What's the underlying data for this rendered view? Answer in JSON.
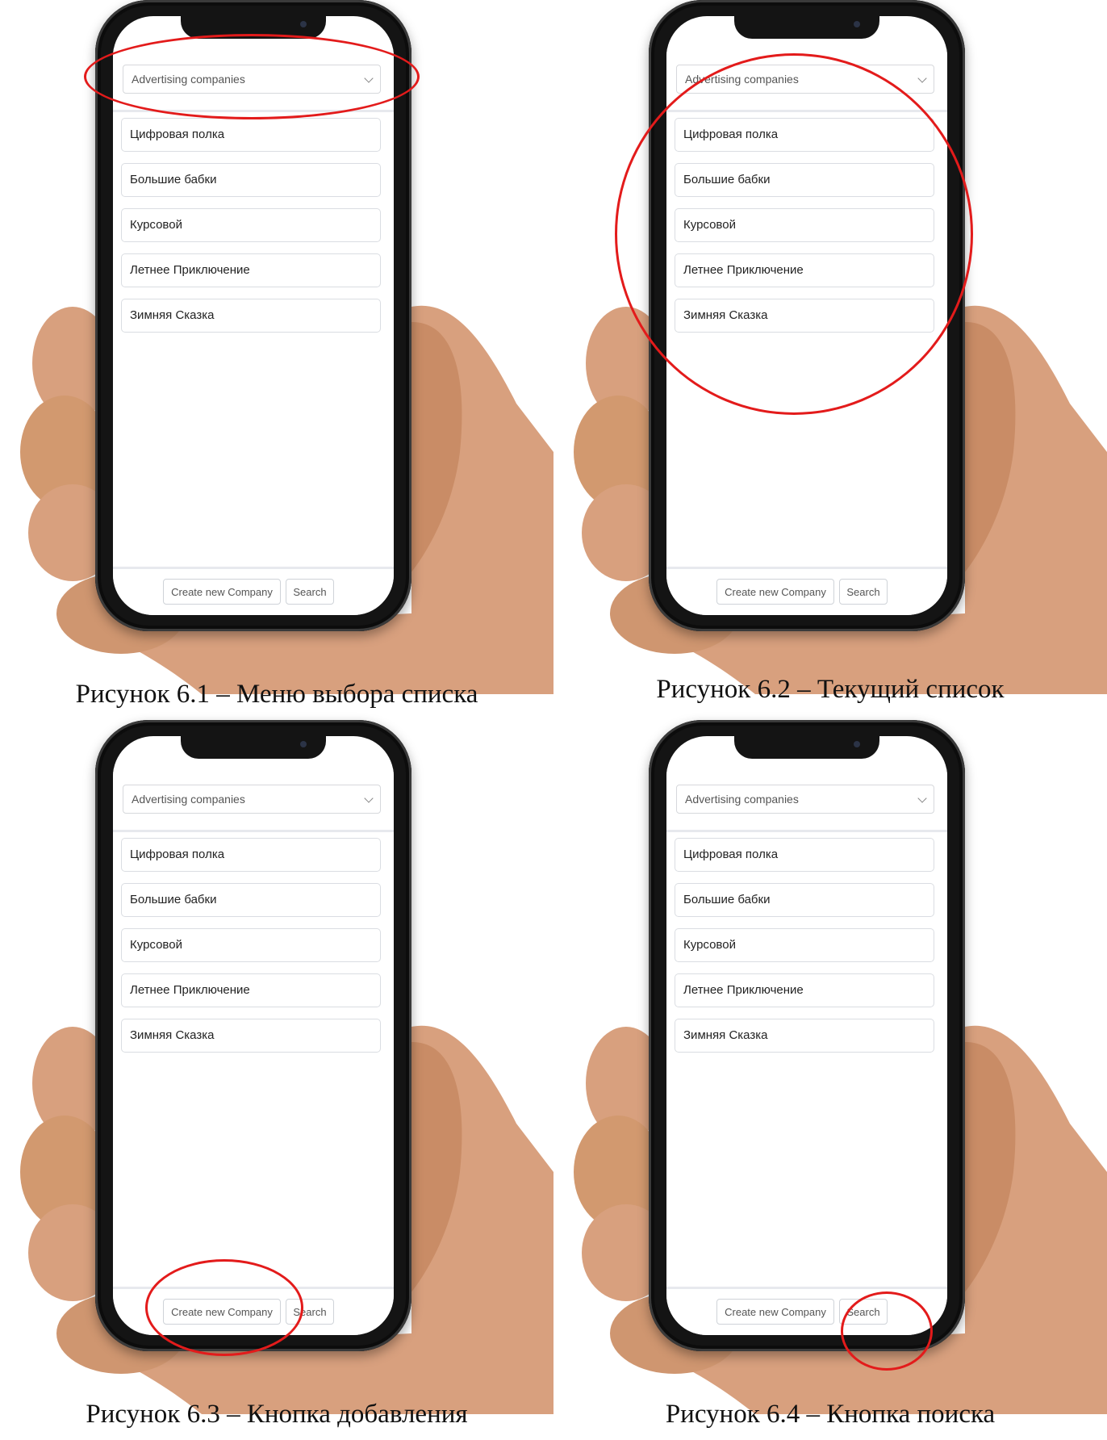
{
  "app": {
    "select_value": "Advertising companies",
    "list_items": [
      "Цифровая полка",
      "Большие бабки",
      "Курсовой",
      "Летнее Приключение",
      "Зимняя Сказка"
    ],
    "create_button": "Create new Company",
    "search_button": "Search"
  },
  "captions": [
    "Рисунок 6.1 – Меню выбора списка",
    "Рисунок 6.2 – Текущий список",
    "Рисунок 6.3 – Кнопка добавления",
    "Рисунок 6.4 – Кнопка поиска"
  ],
  "colors": {
    "highlight": "#e31b1b",
    "skin": "#d8a07e",
    "phone_frame": "#141414"
  },
  "highlights": [
    "select-menu",
    "company-list",
    "create-button",
    "search-button"
  ]
}
